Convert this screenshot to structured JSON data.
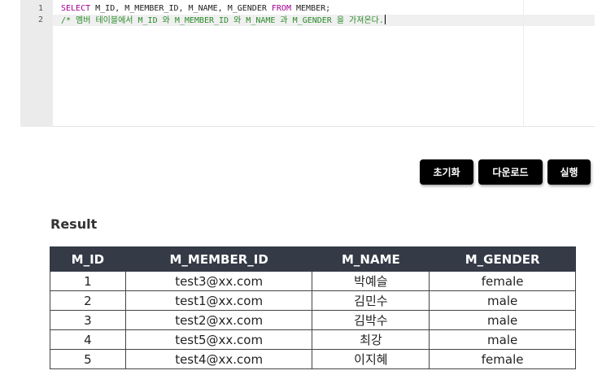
{
  "editor": {
    "line_numbers": [
      "1",
      "2"
    ],
    "line1": {
      "kw1": "SELECT",
      "mid": " M_ID, M_MEMBER_ID, M_NAME, M_GENDER ",
      "kw2": "FROM",
      "tail": " MEMBER;"
    },
    "line2": {
      "comment": "/* 멤버 테이블에서 M_ID 와 M_MEMBER_ID 와 M_NAME 과 M_GENDER 을 가져온다."
    }
  },
  "buttons": {
    "reset": "초기화",
    "download": "다운로드",
    "run": "실행"
  },
  "result": {
    "title": "Result",
    "columns": [
      "M_ID",
      "M_MEMBER_ID",
      "M_NAME",
      "M_GENDER"
    ],
    "rows": [
      [
        "1",
        "test3@xx.com",
        "박예슬",
        "female"
      ],
      [
        "2",
        "test1@xx.com",
        "김민수",
        "male"
      ],
      [
        "3",
        "test2@xx.com",
        "김박수",
        "male"
      ],
      [
        "4",
        "test5@xx.com",
        "최강",
        "male"
      ],
      [
        "5",
        "test4@xx.com",
        "이지혜",
        "female"
      ]
    ]
  },
  "colors": {
    "keyword": "#a30090",
    "comment": "#2b8a2b",
    "table_header": "#353a47",
    "button": "#000000"
  }
}
